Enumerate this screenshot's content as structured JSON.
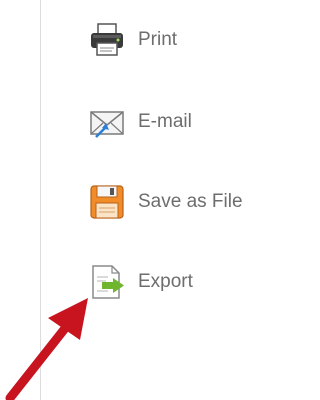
{
  "menu": {
    "items": [
      {
        "label": "Print",
        "icon": "printer-icon"
      },
      {
        "label": "E-mail",
        "icon": "envelope-icon"
      },
      {
        "label": "Save as File",
        "icon": "floppy-disk-icon"
      },
      {
        "label": "Export",
        "icon": "export-icon"
      }
    ]
  },
  "colors": {
    "label_text": "#6d6d6d",
    "divider": "#dcdcdc",
    "annotation_arrow": "#c8141e",
    "floppy": "#f28c28",
    "export_arrow": "#6fb52d"
  }
}
